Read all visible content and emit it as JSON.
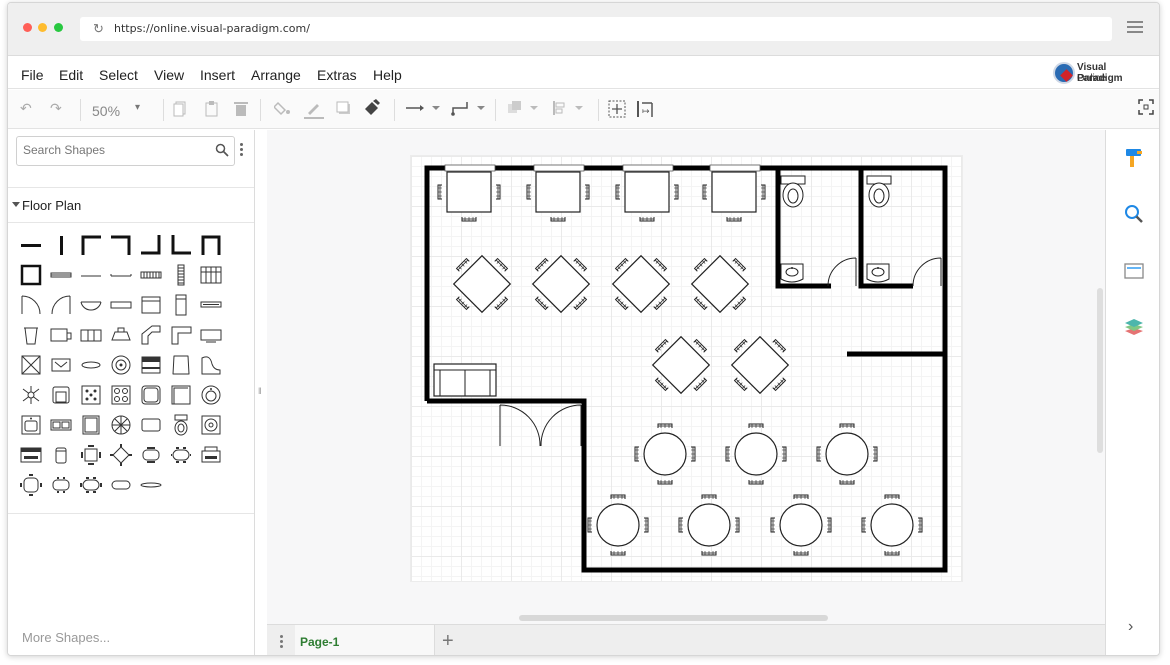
{
  "browser": {
    "url": "https://online.visual-paradigm.com/",
    "traffic_colors": [
      "#ff5f57",
      "#febc2e",
      "#28c840"
    ]
  },
  "menubar": {
    "items": [
      "File",
      "Edit",
      "Select",
      "View",
      "Insert",
      "Arrange",
      "Extras",
      "Help"
    ],
    "logo_line1": "Visual Paradigm",
    "logo_line2": "Online"
  },
  "toolbar": {
    "zoom": "50%",
    "icons": [
      "undo-icon",
      "redo-icon",
      "zoom-dropdown-icon",
      "copy-icon",
      "paste-icon",
      "delete-icon",
      "fill-color-icon",
      "line-color-icon",
      "shadow-icon",
      "format-painter-icon",
      "connector-style-icon",
      "waypoint-style-icon",
      "to-front-icon",
      "align-icon",
      "select-all-icon",
      "fit-page-icon",
      "fullscreen-icon"
    ]
  },
  "sidebar": {
    "search_placeholder": "Search Shapes",
    "section_title": "Floor Plan",
    "more_shapes": "More Shapes..."
  },
  "pages": {
    "current": "Page-1"
  },
  "right_panel": {
    "icons": [
      "format-icon",
      "search-icon",
      "page-setup-icon",
      "layers-icon",
      "expand-chevron-icon"
    ]
  },
  "colors": {
    "wall": "#000000",
    "page_tab_text": "#2e7d32",
    "accent_blue": "#1e88e5",
    "accent_orange": "#f5a623"
  }
}
